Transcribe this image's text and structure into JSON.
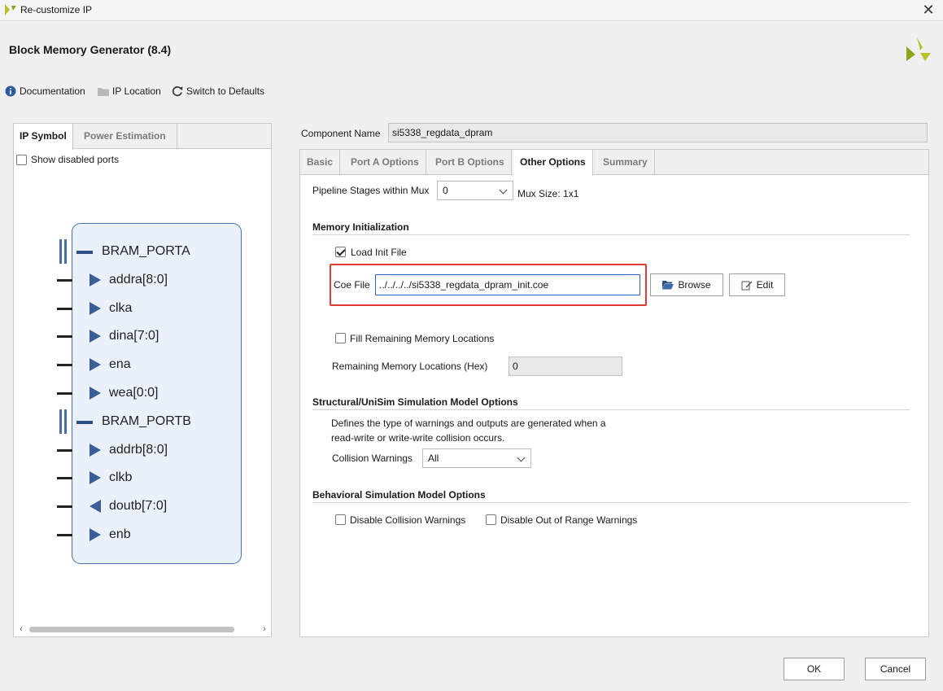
{
  "window": {
    "title": "Re-customize IP",
    "close_glyph": "✕"
  },
  "header": {
    "title": "Block Memory Generator (8.4)",
    "logo_icon": "xilinx-logo"
  },
  "toolbar": {
    "documentation": "Documentation",
    "ip_location": "IP Location",
    "switch_defaults": "Switch to Defaults"
  },
  "left": {
    "tabs": [
      "IP Symbol",
      "Power Estimation"
    ],
    "show_disabled_ports": "Show disabled ports",
    "scroll_left": "‹",
    "scroll_right": "›"
  },
  "symbol": {
    "bus_a": "BRAM_PORTA",
    "ports_a": [
      "addra[8:0]",
      "clka",
      "dina[7:0]",
      "ena",
      "wea[0:0]"
    ],
    "bus_b": "BRAM_PORTB",
    "ports_b": [
      "addrb[8:0]",
      "clkb",
      "doutb[7:0]",
      "enb"
    ]
  },
  "component": {
    "label": "Component Name",
    "value": "si5338_regdata_dpram"
  },
  "tabs": [
    "Basic",
    "Port A Options",
    "Port B Options",
    "Other Options",
    "Summary"
  ],
  "active_tab": "Other Options",
  "pipeline": {
    "label": "Pipeline Stages within Mux",
    "value": "0",
    "mux_size": "Mux Size: 1x1"
  },
  "mem_init": {
    "title": "Memory Initialization",
    "load_init": "Load Init File",
    "load_init_checked": true,
    "coe_label": "Coe File",
    "coe_value": "../../../../si5338_regdata_dpram_init.coe",
    "browse": "Browse",
    "edit": "Edit",
    "fill_remaining": "Fill Remaining Memory Locations",
    "fill_checked": false,
    "remaining_label": "Remaining Memory Locations (Hex)",
    "remaining_value": "0"
  },
  "structural": {
    "title": "Structural/UniSim Simulation Model Options",
    "desc1": "Defines the type of warnings and outputs are generated when a",
    "desc2": "read-write or write-write collision occurs.",
    "collision_label": "Collision Warnings",
    "collision_value": "All"
  },
  "behavioral": {
    "title": "Behavioral Simulation Model Options",
    "disable_collision": "Disable Collision Warnings",
    "disable_out_of_range": "Disable Out of Range Warnings"
  },
  "buttons": {
    "ok": "OK",
    "cancel": "Cancel"
  },
  "colors": {
    "accent": "#2c64c8",
    "highlight": "#e23c2f",
    "symbol_fill": "#eaf1fa",
    "symbol_border": "#4a6fa5"
  }
}
